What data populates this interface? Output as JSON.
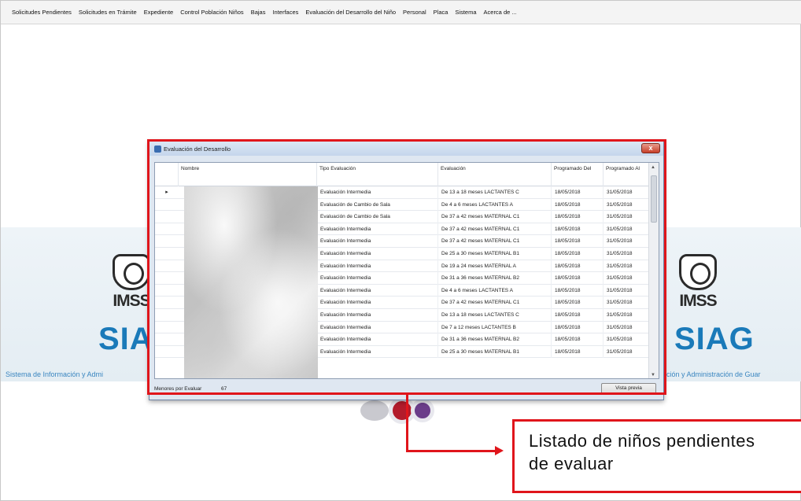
{
  "menu": [
    "Solicitudes Pendientes",
    "Solicitudes en Trámite",
    "Expediente",
    "Control Población Niños",
    "Bajas",
    "Interfaces",
    "Evaluación del Desarrollo del Niño",
    "Personal",
    "Placa",
    "Sistema",
    "Acerca de ..."
  ],
  "branding": {
    "logo_text": "IMSS",
    "app_name_left": "SIA",
    "app_name_right": "SIAG",
    "tagline_left": "Sistema de Información y Admi",
    "tagline_right": "ción y Administración de Guar"
  },
  "window": {
    "title": "Evaluación del Desarrollo",
    "close_label": "x",
    "columns": {
      "nombre": "Nombre",
      "tipo": "Tipo Evaluación",
      "evaluacion": "Evaluación",
      "del": "Programado Del",
      "al": "Programado Al"
    },
    "row_indicator": "▸",
    "rows": [
      {
        "tipo": "Evaluación Intermedia",
        "evaluacion": "De 13 a 18 meses LACTANTES C",
        "del": "18/05/2018",
        "al": "31/05/2018"
      },
      {
        "tipo": "Evaluación de Cambio de Sala",
        "evaluacion": "De 4 a 6 meses LACTANTES A",
        "del": "18/05/2018",
        "al": "31/05/2018"
      },
      {
        "tipo": "Evaluación de Cambio de Sala",
        "evaluacion": "De 37 a 42 meses MATERNAL C1",
        "del": "18/05/2018",
        "al": "31/05/2018"
      },
      {
        "tipo": "Evaluación Intermedia",
        "evaluacion": "De 37 a 42 meses MATERNAL C1",
        "del": "18/05/2018",
        "al": "31/05/2018"
      },
      {
        "tipo": "Evaluación Intermedia",
        "evaluacion": "De 37 a 42 meses MATERNAL C1",
        "del": "18/05/2018",
        "al": "31/05/2018"
      },
      {
        "tipo": "Evaluación Intermedia",
        "evaluacion": "De 25 a 30 meses MATERNAL B1",
        "del": "18/05/2018",
        "al": "31/05/2018"
      },
      {
        "tipo": "Evaluación Intermedia",
        "evaluacion": "De 19 a 24 meses MATERNAL A",
        "del": "18/05/2018",
        "al": "31/05/2018"
      },
      {
        "tipo": "Evaluación Intermedia",
        "evaluacion": "De 31 a 36 meses MATERNAL B2",
        "del": "18/05/2018",
        "al": "31/05/2018"
      },
      {
        "tipo": "Evaluación Intermedia",
        "evaluacion": "De 4 a 6 meses LACTANTES A",
        "del": "18/05/2018",
        "al": "31/05/2018"
      },
      {
        "tipo": "Evaluación Intermedia",
        "evaluacion": "De 37 a 42 meses MATERNAL C1",
        "del": "18/05/2018",
        "al": "31/05/2018"
      },
      {
        "tipo": "Evaluación Intermedia",
        "evaluacion": "De 13 a 18 meses LACTANTES C",
        "del": "18/05/2018",
        "al": "31/05/2018"
      },
      {
        "tipo": "Evaluación Intermedia",
        "evaluacion": "De 7 a 12 meses LACTANTES B",
        "del": "18/05/2018",
        "al": "31/05/2018"
      },
      {
        "tipo": "Evaluación Intermedia",
        "evaluacion": "De 31 a 36 meses MATERNAL B2",
        "del": "18/05/2018",
        "al": "31/05/2018"
      },
      {
        "tipo": "Evaluación Intermedia",
        "evaluacion": "De 25 a 30 meses MATERNAL B1",
        "del": "18/05/2018",
        "al": "31/05/2018"
      }
    ],
    "status_label": "Menores por Evaluar",
    "status_count": "67",
    "preview_button": "Vista previa"
  },
  "callout": {
    "line1": "Listado de niños pendientes",
    "line2": "de evaluar"
  },
  "colors": {
    "annotation_red": "#e0151b",
    "siag_blue": "#1a7ab9"
  }
}
